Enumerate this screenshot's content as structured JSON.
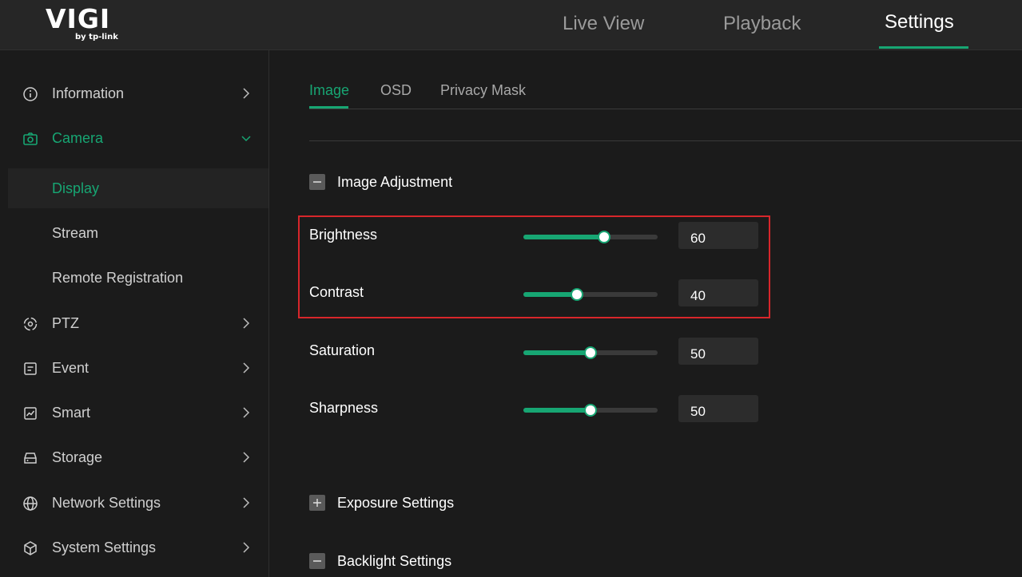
{
  "brand": {
    "name": "VIGI",
    "sub": "by tp-link"
  },
  "topnav": [
    {
      "label": "Live View",
      "active": false
    },
    {
      "label": "Playback",
      "active": false
    },
    {
      "label": "Settings",
      "active": true
    }
  ],
  "sidebar": {
    "items": [
      {
        "label": "Information",
        "icon": "info-icon"
      },
      {
        "label": "Camera",
        "icon": "camera-icon",
        "expanded": true
      },
      {
        "label": "PTZ",
        "icon": "ptz-icon"
      },
      {
        "label": "Event",
        "icon": "event-icon"
      },
      {
        "label": "Smart",
        "icon": "smart-icon"
      },
      {
        "label": "Storage",
        "icon": "storage-icon"
      },
      {
        "label": "Network Settings",
        "icon": "globe-icon"
      },
      {
        "label": "System Settings",
        "icon": "system-icon"
      }
    ],
    "camera_sub": [
      {
        "label": "Display",
        "active": true
      },
      {
        "label": "Stream",
        "active": false
      },
      {
        "label": "Remote Registration",
        "active": false
      }
    ]
  },
  "tabs": [
    {
      "label": "Image",
      "active": true
    },
    {
      "label": "OSD",
      "active": false
    },
    {
      "label": "Privacy Mask",
      "active": false
    }
  ],
  "sections": {
    "image_adjustment": {
      "title": "Image Adjustment",
      "expanded": true
    },
    "exposure": {
      "title": "Exposure Settings",
      "expanded": false
    },
    "backlight": {
      "title": "Backlight Settings",
      "expanded": true
    }
  },
  "adjustments": [
    {
      "label": "Brightness",
      "value": "60"
    },
    {
      "label": "Contrast",
      "value": "40"
    },
    {
      "label": "Saturation",
      "value": "50"
    },
    {
      "label": "Sharpness",
      "value": "50"
    }
  ],
  "colors": {
    "accent": "#17a673",
    "highlight": "#d8262b",
    "background": "#1b1b1b"
  }
}
